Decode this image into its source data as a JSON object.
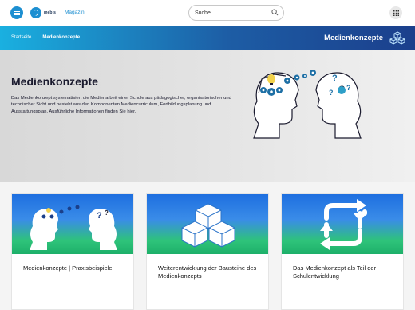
{
  "header": {
    "logo_text": "mebis",
    "magazin_link": "Magazin",
    "search_placeholder": "Suche"
  },
  "breadcrumb": {
    "home": "Startseite",
    "separator": "→",
    "current": "Medienkonzepte"
  },
  "banner": {
    "title": "Medienkonzepte"
  },
  "hero": {
    "title": "Medienkonzepte",
    "text": "Das Medienkonzept systematisiert die Medienarbeit einer Schule aus pädagogischer, organisatorischer und technischer Sicht und besteht aus den Komponenten Mediencurriculum, Fortbildungsplanung und Ausstattungsplan. Ausführliche Informationen finden Sie hier."
  },
  "cards": [
    {
      "label": "Medienkonzepte | Praxisbeispiele",
      "icon": "heads-exchange-icon"
    },
    {
      "label": "Weiterentwicklung der Bausteine des Medienkonzepts",
      "icon": "cubes-icon"
    },
    {
      "label": "Das Medienkonzept als Teil der Schulentwicklung",
      "icon": "cycle-arrows-icon"
    }
  ],
  "colors": {
    "accent": "#1d8fd1",
    "banner_start": "#1ab0e0",
    "banner_end": "#1b3f8c",
    "card_blue": "#1e6fe0",
    "card_green": "#2ec37a",
    "gear_blue": "#1d6fa5",
    "bulb_yellow": "#f2d24b"
  }
}
